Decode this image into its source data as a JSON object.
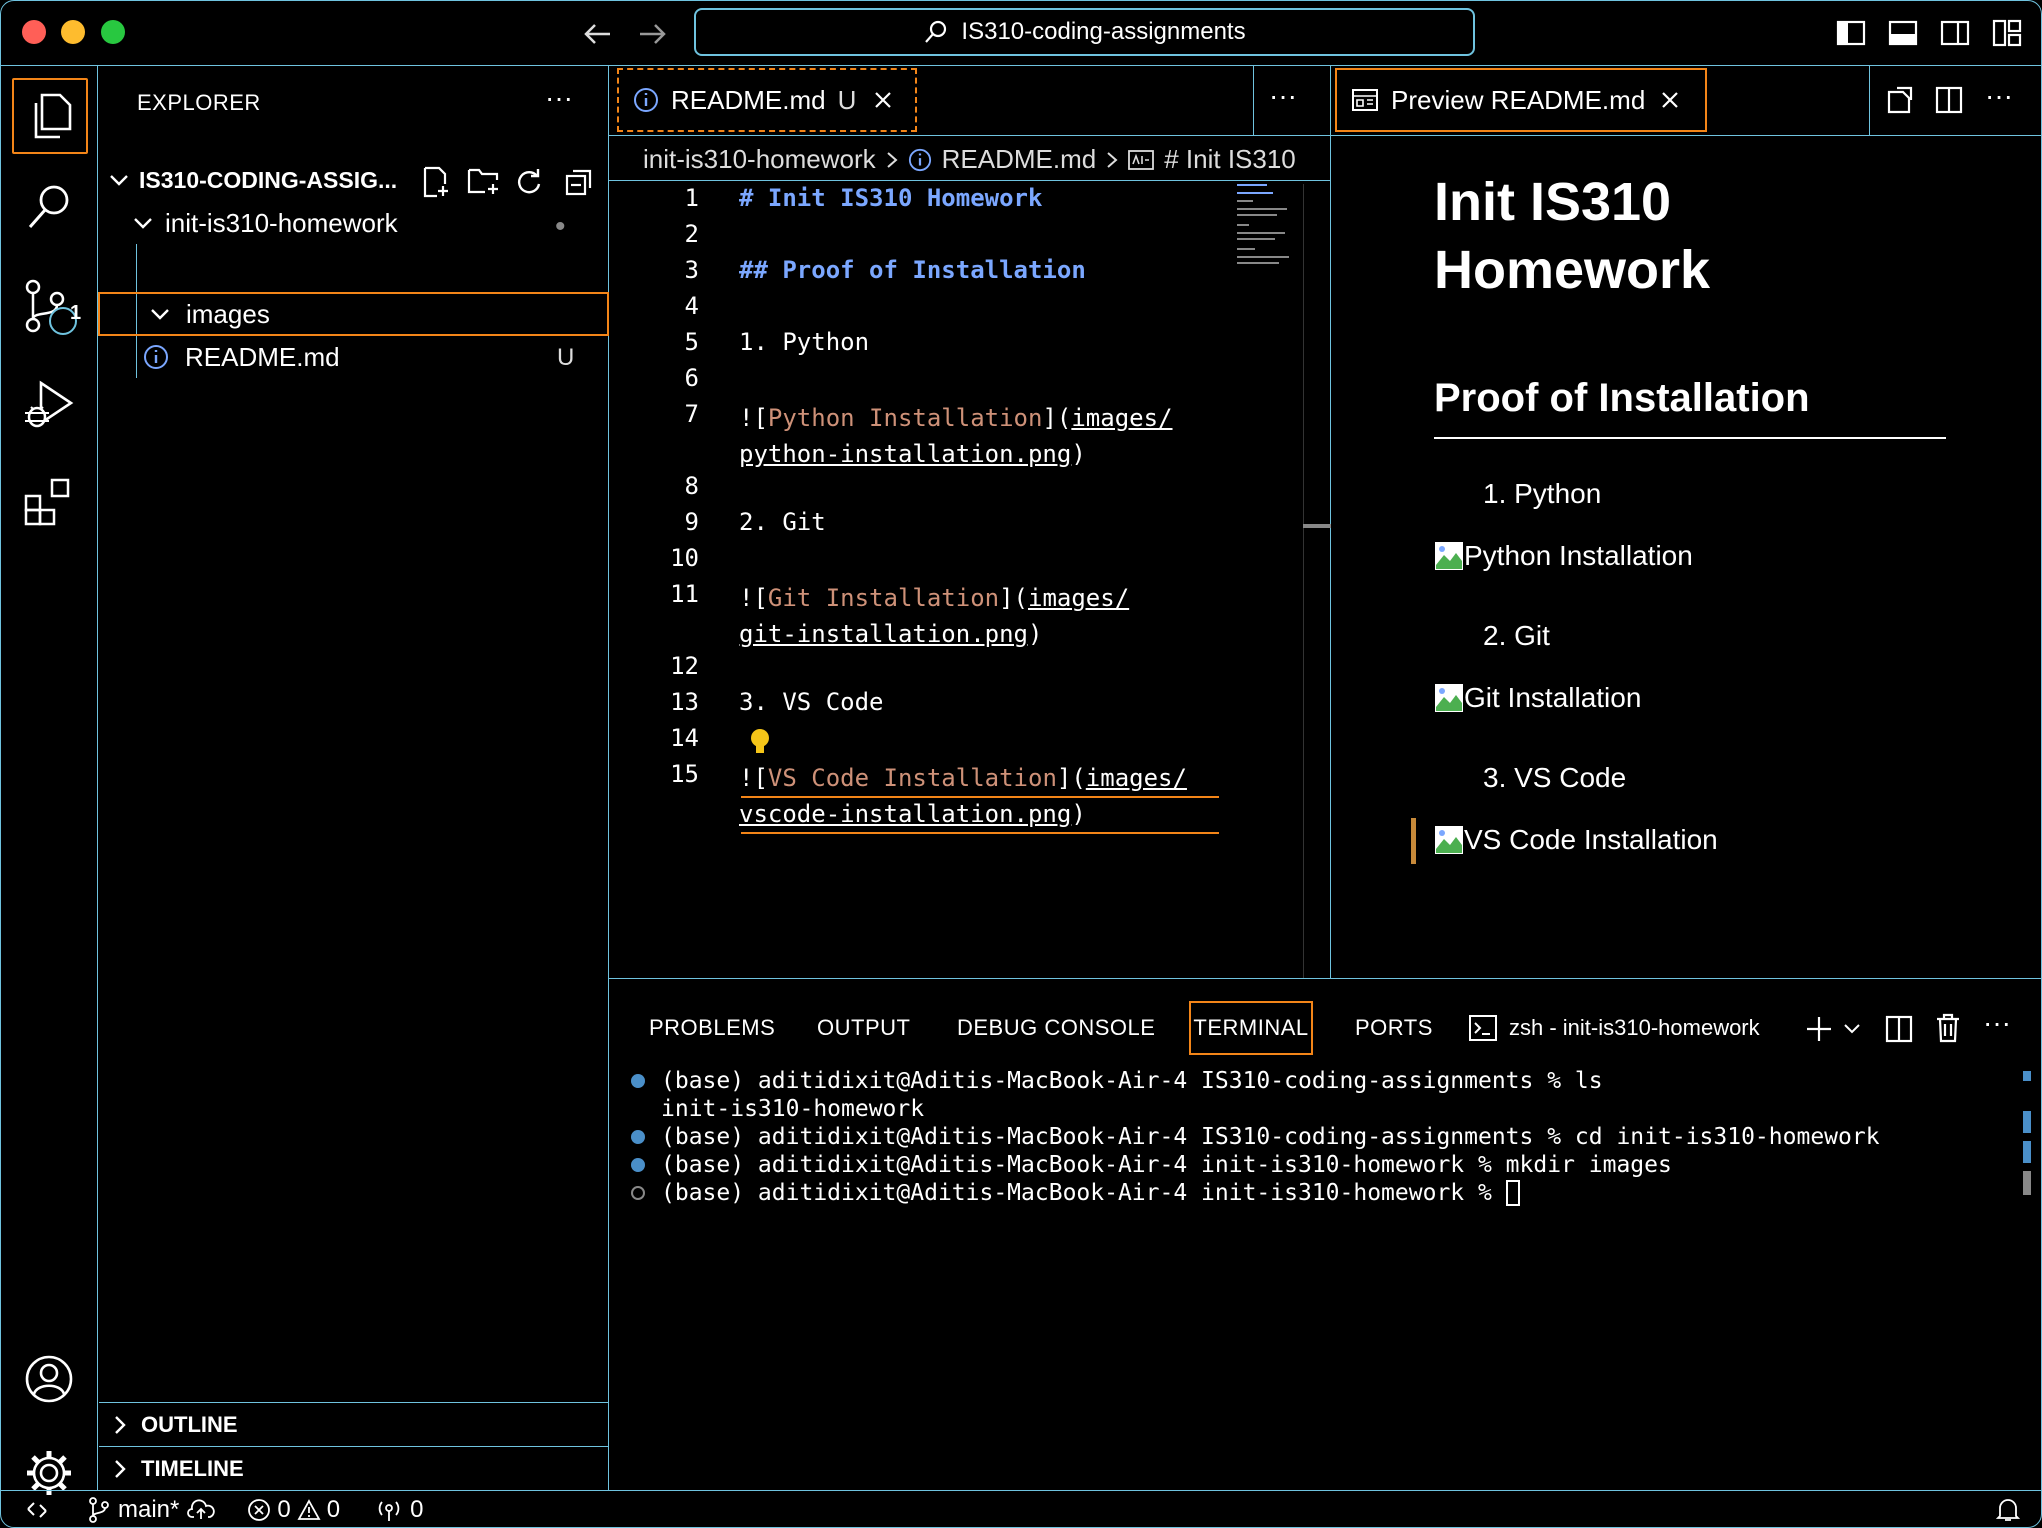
{
  "window": {
    "search_text": "IS310-coding-assignments"
  },
  "sidebar": {
    "title": "EXPLORER",
    "root": "IS310-CODING-ASSIG...",
    "items": [
      {
        "label": "init-is310-homework",
        "badge": "•"
      },
      {
        "label": "images"
      },
      {
        "label": "README.md",
        "badge": "U"
      }
    ],
    "outline": "OUTLINE",
    "timeline": "TIMELINE"
  },
  "editor": {
    "tab_label": "README.md",
    "tab_badge": "U",
    "breadcrumb": [
      "init-is310-homework",
      "README.md",
      "# Init IS310"
    ],
    "lines": [
      {
        "n": "1",
        "text": "# Init IS310 Homework",
        "kind": "h1"
      },
      {
        "n": "2",
        "text": "",
        "kind": "plain"
      },
      {
        "n": "3",
        "text": "## Proof of Installation",
        "kind": "h1"
      },
      {
        "n": "4",
        "text": "",
        "kind": "plain"
      },
      {
        "n": "5",
        "text": "1. Python",
        "kind": "plain"
      },
      {
        "n": "6",
        "text": "",
        "kind": "plain"
      },
      {
        "n": "7",
        "alt": "Python Installation",
        "url1": "images/",
        "url2": "python-installation.png",
        "kind": "img"
      },
      {
        "n": "8",
        "text": "",
        "kind": "plain"
      },
      {
        "n": "9",
        "text": "2. Git",
        "kind": "plain"
      },
      {
        "n": "10",
        "text": "",
        "kind": "plain"
      },
      {
        "n": "11",
        "alt": "Git Installation",
        "url1": "images/",
        "url2": "git-installation.png",
        "kind": "img"
      },
      {
        "n": "12",
        "text": "",
        "kind": "plain"
      },
      {
        "n": "13",
        "text": "3. VS Code",
        "kind": "plain"
      },
      {
        "n": "14",
        "text": "",
        "kind": "plain"
      },
      {
        "n": "15",
        "alt": "VS Code Installation",
        "url1": "images/",
        "url2": "vscode-installation.png",
        "kind": "img"
      }
    ]
  },
  "preview": {
    "tab_label": "Preview README.md",
    "h1_line1": "Init IS310",
    "h1_line2": "Homework",
    "h2": "Proof of Installation",
    "items": [
      {
        "label": "1. Python",
        "image_alt": "Python Installation"
      },
      {
        "label": "2. Git",
        "image_alt": "Git Installation"
      },
      {
        "label": "3. VS Code",
        "image_alt": "VS Code Installation"
      }
    ]
  },
  "panel": {
    "tabs": [
      "PROBLEMS",
      "OUTPUT",
      "DEBUG CONSOLE",
      "TERMINAL",
      "PORTS"
    ],
    "active_tab": "TERMINAL",
    "terminal_name": "zsh - init-is310-homework",
    "lines": [
      {
        "dot": "blue",
        "text": "(base) aditidixit@Aditis-MacBook-Air-4 IS310-coding-assignments % ls"
      },
      {
        "dot": "none",
        "text": "init-is310-homework"
      },
      {
        "dot": "blue",
        "text": "(base) aditidixit@Aditis-MacBook-Air-4 IS310-coding-assignments % cd init-is310-homework"
      },
      {
        "dot": "blue",
        "text": "(base) aditidixit@Aditis-MacBook-Air-4 init-is310-homework % mkdir images"
      },
      {
        "dot": "hollow",
        "text": "(base) aditidixit@Aditis-MacBook-Air-4 init-is310-homework % "
      }
    ]
  },
  "status": {
    "branch": "main*",
    "errors": "0",
    "warnings": "0",
    "ports": "0"
  },
  "scm_badge": "1",
  "colors": {
    "contrast_border": "#6fc3df",
    "active_border": "#f38518",
    "heading": "#7ba7ff",
    "link_text": "#ce9178",
    "terminal_dot": "#4a8fc9"
  }
}
